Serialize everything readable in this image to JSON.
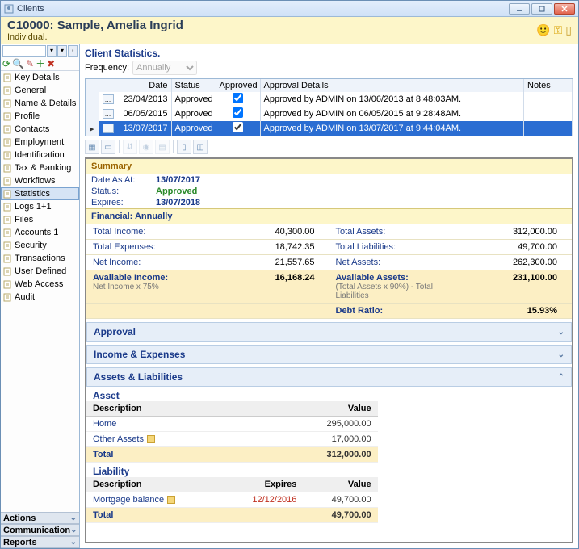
{
  "window": {
    "title": "Clients"
  },
  "header": {
    "title": "C10000: Sample, Amelia Ingrid",
    "subtitle": "Individual."
  },
  "nav": {
    "items": [
      "Key Details",
      "General",
      "Name & Details",
      "Profile",
      "Contacts",
      "Employment",
      "Identification",
      "Tax & Banking",
      "Workflows",
      "Statistics",
      "Logs  1+1",
      "Files",
      "Accounts  1",
      "Security",
      "Transactions",
      "User Defined",
      "Web Access",
      "Audit"
    ],
    "selected_index": 9,
    "sections": [
      "Actions",
      "Communication",
      "Reports"
    ]
  },
  "main": {
    "title": "Client Statistics.",
    "frequency_label": "Frequency:",
    "frequency_value": "Annually",
    "grid": {
      "headers": [
        "Date",
        "Status",
        "Approved",
        "Approval Details",
        "Notes"
      ],
      "rows": [
        {
          "date": "23/04/2013",
          "status": "Approved",
          "approved": true,
          "details": "Approved by ADMIN on 13/06/2013 at 8:48:03AM.",
          "notes": ""
        },
        {
          "date": "06/05/2015",
          "status": "Approved",
          "approved": true,
          "details": "Approved by ADMIN on 06/05/2015 at 9:28:48AM.",
          "notes": ""
        },
        {
          "date": "13/07/2017",
          "status": "Approved",
          "approved": true,
          "details": "Approved by ADMIN on 13/07/2017 at 9:44:04AM.",
          "notes": ""
        }
      ],
      "selected_row": 2
    }
  },
  "summary": {
    "header": "Summary",
    "date_as_at_label": "Date As At:",
    "date_as_at": "13/07/2017",
    "status_label": "Status:",
    "status": "Approved",
    "expires_label": "Expires:",
    "expires": "13/07/2018"
  },
  "financial": {
    "header": "Financial: Annually",
    "total_income_label": "Total Income:",
    "total_income": "40,300.00",
    "total_expenses_label": "Total Expenses:",
    "total_expenses": "18,742.35",
    "net_income_label": "Net Income:",
    "net_income": "21,557.65",
    "total_assets_label": "Total Assets:",
    "total_assets": "312,000.00",
    "total_liabilities_label": "Total Liabilities:",
    "total_liabilities": "49,700.00",
    "net_assets_label": "Net Assets:",
    "net_assets": "262,300.00",
    "avail_income_label": "Available Income:",
    "avail_income_sub": "Net Income x 75%",
    "avail_income": "16,168.24",
    "avail_assets_label": "Available Assets:",
    "avail_assets_sub": "(Total Assets x 90%)  -  Total Liabilities",
    "avail_assets": "231,100.00",
    "debt_ratio_label": "Debt Ratio:",
    "debt_ratio": "15.93%"
  },
  "accordion": {
    "approval": "Approval",
    "income_expenses": "Income & Expenses",
    "assets_liabilities": "Assets & Liabilities"
  },
  "assets": {
    "asset_header": "Asset",
    "col_desc": "Description",
    "col_value": "Value",
    "col_expires": "Expires",
    "rows": [
      {
        "desc": "Home",
        "value": "295,000.00"
      },
      {
        "desc": "Other Assets",
        "value": "17,000.00",
        "note": true
      }
    ],
    "total_label": "Total",
    "total_value": "312,000.00",
    "liab_header": "Liability",
    "liab_rows": [
      {
        "desc": "Mortgage balance",
        "expires": "12/12/2016",
        "value": "49,700.00",
        "note": true,
        "expired": true
      }
    ],
    "liab_total_value": "49,700.00"
  }
}
